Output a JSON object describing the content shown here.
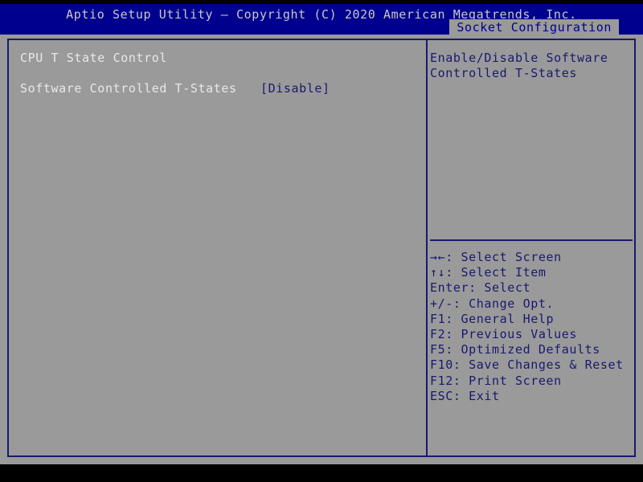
{
  "titlebar": {
    "title": "Aptio Setup Utility – Copyright (C) 2020 American Megatrends, Inc."
  },
  "tabs": [
    {
      "label": "Socket Configuration",
      "active": true
    }
  ],
  "main": {
    "section_title": "CPU T State Control",
    "settings": [
      {
        "label": "Software Controlled T-States",
        "value": "[Disable]"
      }
    ]
  },
  "help": {
    "description_lines": [
      "Enable/Disable Software",
      "Controlled T-States"
    ],
    "legend": [
      "→←: Select Screen",
      "↑↓: Select Item",
      "Enter: Select",
      "+/-: Change Opt.",
      "F1: General Help",
      "F2: Previous Values",
      "F5: Optimized Defaults",
      "F10: Save Changes & Reset",
      "F12: Print Screen",
      "ESC: Exit"
    ]
  },
  "colors": {
    "title_bar_bg": "#00008f",
    "panel_bg": "#9a9a9a",
    "frame_border": "#191970",
    "value_text": "#191970",
    "label_text": "#e8e8e8",
    "tab_bg": "#9a9a9a",
    "tab_text": "#00008f",
    "screen_bg": "#000000"
  }
}
